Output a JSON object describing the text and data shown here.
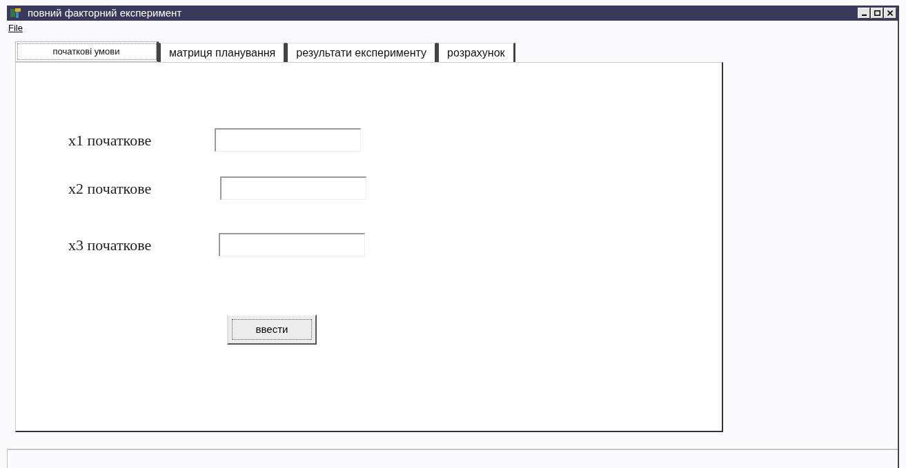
{
  "window": {
    "title": "повний факторний експеримент"
  },
  "menu": [
    "File"
  ],
  "tabs": [
    {
      "label": "початкові умови",
      "selected": true
    },
    {
      "label": "матриця планування",
      "selected": false
    },
    {
      "label": "результати експерименту",
      "selected": false
    },
    {
      "label": "розрахунок",
      "selected": false
    }
  ],
  "fields": [
    {
      "label": "x1 початкове"
    },
    {
      "label": "x2 початкове"
    },
    {
      "label": "x3 початкове"
    }
  ],
  "button": "ввести"
}
